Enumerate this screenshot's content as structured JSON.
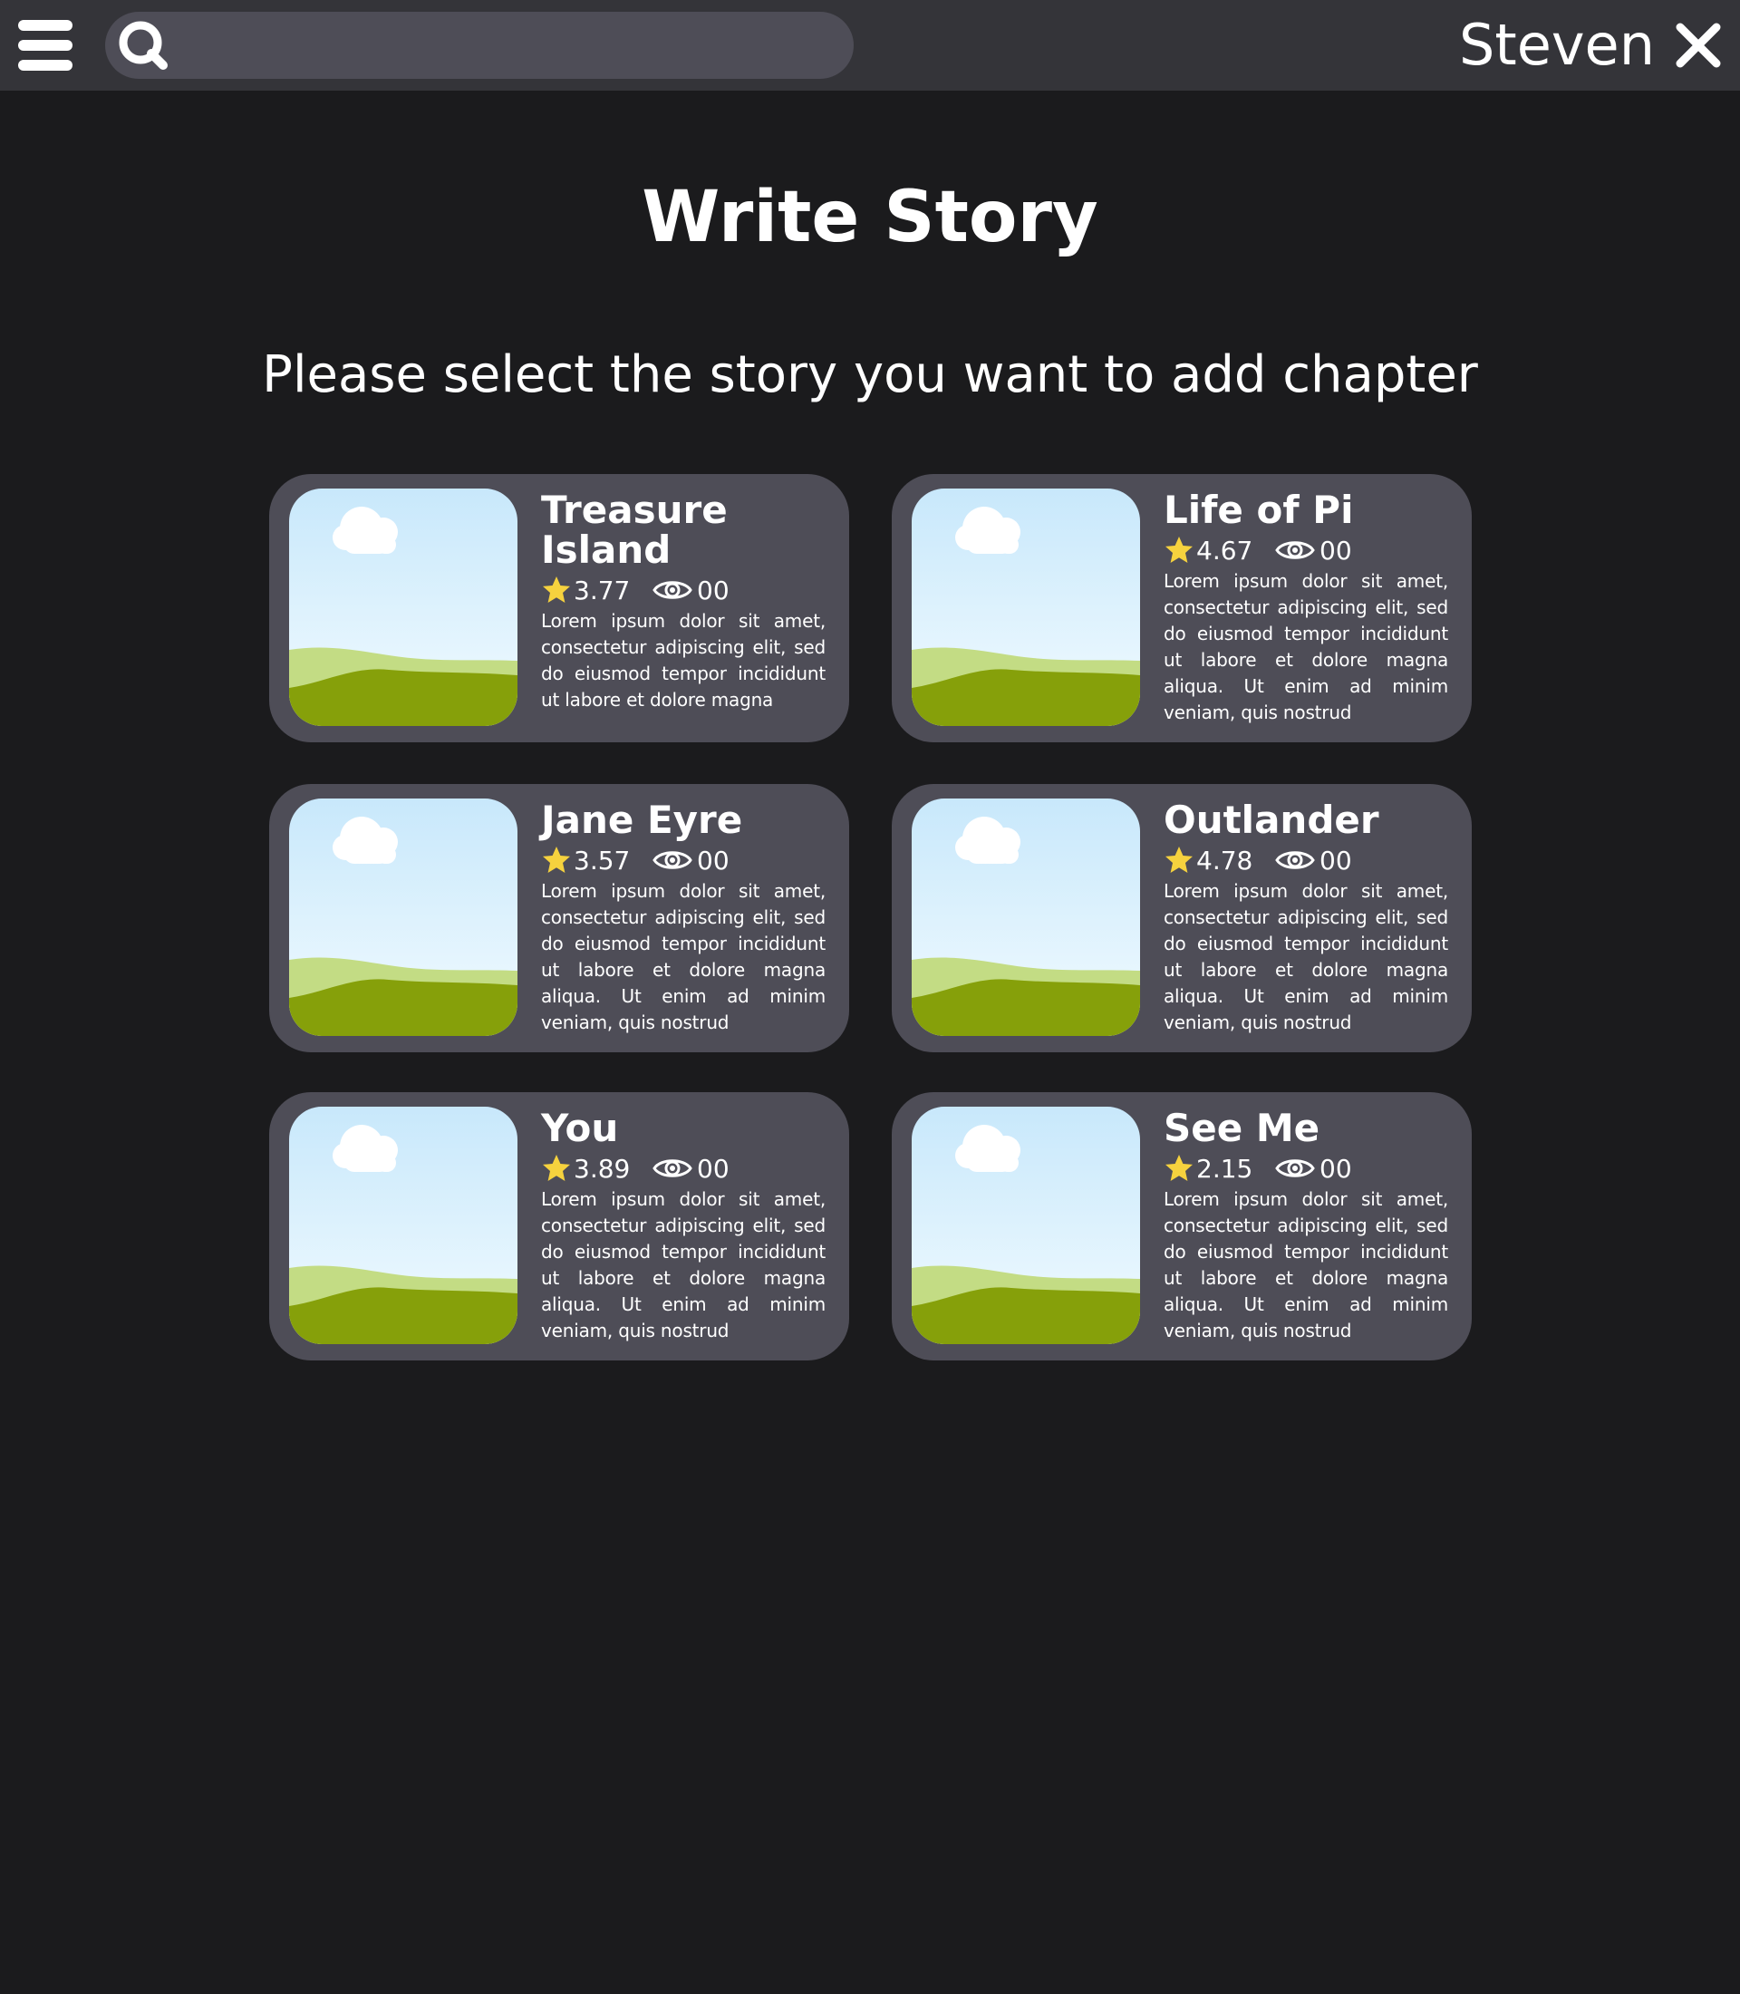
{
  "header": {
    "menu_icon": "hamburger-menu-icon",
    "search_icon": "search-icon",
    "search_placeholder": "",
    "username": "Steven",
    "close_icon": "close-icon"
  },
  "main": {
    "title": "Write Story",
    "subtitle": "Please select the story you want to add chapter"
  },
  "stories": [
    {
      "title": "Treasure Island",
      "rating": "3.77",
      "views": "00",
      "description": "Lorem ipsum dolor sit amet, consectetur adipiscing elit, sed do eiusmod tempor incididunt ut labore et dolore magna"
    },
    {
      "title": "Life of Pi",
      "rating": "4.67",
      "views": "00",
      "description": "Lorem ipsum dolor sit amet, consectetur adipiscing elit, sed do eiusmod tempor incididunt ut labore et dolore magna aliqua. Ut enim ad minim veniam, quis nostrud"
    },
    {
      "title": "Jane Eyre",
      "rating": "3.57",
      "views": "00",
      "description": "Lorem ipsum dolor sit amet, consectetur adipiscing elit, sed do eiusmod tempor incididunt ut labore et dolore magna aliqua. Ut enim ad minim veniam, quis nostrud"
    },
    {
      "title": "Outlander",
      "rating": "4.78",
      "views": "00",
      "description": "Lorem ipsum dolor sit amet, consectetur adipiscing elit, sed do eiusmod tempor incididunt ut labore et dolore magna aliqua. Ut enim ad minim veniam, quis nostrud"
    },
    {
      "title": "You",
      "rating": "3.89",
      "views": "00",
      "description": "Lorem ipsum dolor sit amet, consectetur adipiscing elit, sed do eiusmod tempor incididunt ut labore et dolore magna aliqua. Ut enim ad minim veniam, quis nostrud"
    },
    {
      "title": "See Me",
      "rating": "2.15",
      "views": "00",
      "description": "Lorem ipsum dolor sit amet, consectetur adipiscing elit, sed do eiusmod tempor incididunt ut labore et dolore magna aliqua. Ut enim ad minim veniam, quis nostrud"
    }
  ],
  "colors": {
    "background": "#1b1b1d",
    "header": "#343439",
    "card": "#4e4d57",
    "star": "#f6d23e",
    "text": "#ffffff"
  }
}
